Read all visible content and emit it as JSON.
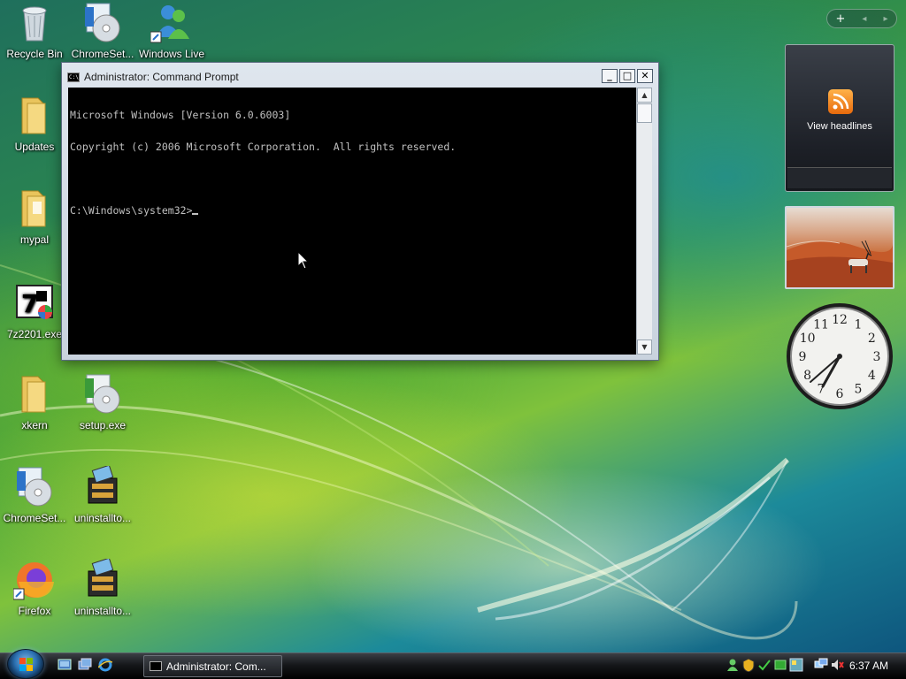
{
  "desktop": {
    "icons": [
      {
        "label": "Recycle Bin"
      },
      {
        "label": "ChromeSet..."
      },
      {
        "label": "Windows Live"
      },
      {
        "label": "Updates"
      },
      {
        "label": "mypal"
      },
      {
        "label": "7z2201.exe"
      },
      {
        "label": "xkern"
      },
      {
        "label": "setup.exe"
      },
      {
        "label": "ChromeSet..."
      },
      {
        "label": "uninstallto..."
      },
      {
        "label": "Firefox"
      },
      {
        "label": "uninstallto..."
      }
    ]
  },
  "window": {
    "title": "Administrator: Command Prompt",
    "icon_text": "C:\\",
    "buttons": {
      "minimize": "_",
      "maximize": "□",
      "close": "✕"
    },
    "console_lines": [
      "Microsoft Windows [Version 6.0.6003]",
      "Copyright (c) 2006 Microsoft Corporation.  All rights reserved.",
      "",
      "C:\\Windows\\system32>"
    ]
  },
  "sidebar": {
    "controls": {
      "add": "+",
      "prev": "◂",
      "next": "▸"
    },
    "feed": {
      "label": "View headlines"
    },
    "clock": {
      "numbers": [
        "12",
        "1",
        "2",
        "3",
        "4",
        "5",
        "6",
        "7",
        "8",
        "9",
        "10",
        "11"
      ]
    }
  },
  "taskbar": {
    "task_button_label": "Administrator: Com...",
    "time": "6:37 AM"
  },
  "colors": {
    "console_bg": "#000000",
    "console_fg": "#c0c0c0",
    "taskbar": "#15171a",
    "rss": "#f0801c"
  }
}
